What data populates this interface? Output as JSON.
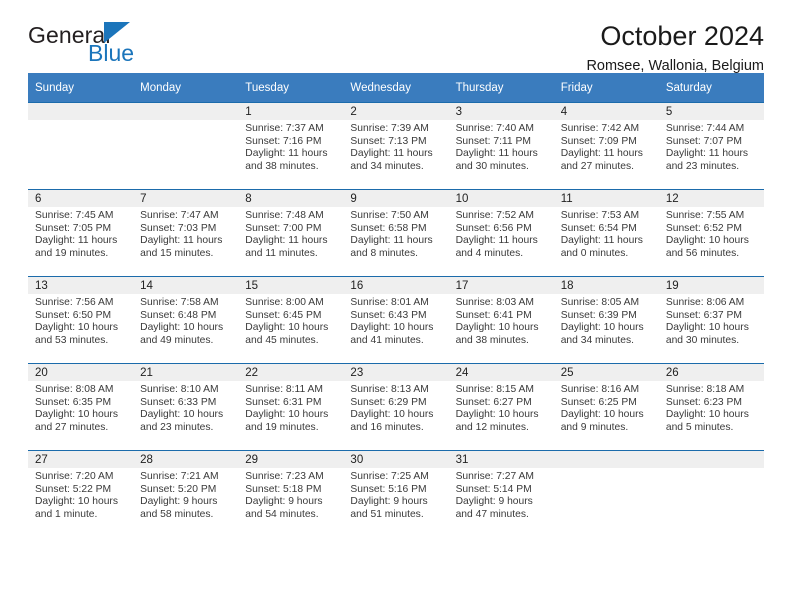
{
  "brand": {
    "name_top": "General",
    "name_bottom": "Blue",
    "triangle_color": "#1b75bb"
  },
  "header": {
    "title": "October 2024",
    "subtitle": "Romsee, Wallonia, Belgium"
  },
  "calendar": {
    "header_bg": "#3a7cbe",
    "row_border_color": "#1b6bab",
    "daynum_bg": "#efefef",
    "weekdays": [
      "Sunday",
      "Monday",
      "Tuesday",
      "Wednesday",
      "Thursday",
      "Friday",
      "Saturday"
    ],
    "labels": {
      "sunrise": "Sunrise:",
      "sunset": "Sunset:",
      "daylight": "Daylight:"
    },
    "weeks": [
      [
        {
          "day": "",
          "empty": true
        },
        {
          "day": "",
          "empty": true
        },
        {
          "day": "1",
          "sunrise": "Sunrise: 7:37 AM",
          "sunset": "Sunset: 7:16 PM",
          "daylight_1": "Daylight: 11 hours",
          "daylight_2": "and 38 minutes."
        },
        {
          "day": "2",
          "sunrise": "Sunrise: 7:39 AM",
          "sunset": "Sunset: 7:13 PM",
          "daylight_1": "Daylight: 11 hours",
          "daylight_2": "and 34 minutes."
        },
        {
          "day": "3",
          "sunrise": "Sunrise: 7:40 AM",
          "sunset": "Sunset: 7:11 PM",
          "daylight_1": "Daylight: 11 hours",
          "daylight_2": "and 30 minutes."
        },
        {
          "day": "4",
          "sunrise": "Sunrise: 7:42 AM",
          "sunset": "Sunset: 7:09 PM",
          "daylight_1": "Daylight: 11 hours",
          "daylight_2": "and 27 minutes."
        },
        {
          "day": "5",
          "sunrise": "Sunrise: 7:44 AM",
          "sunset": "Sunset: 7:07 PM",
          "daylight_1": "Daylight: 11 hours",
          "daylight_2": "and 23 minutes."
        }
      ],
      [
        {
          "day": "6",
          "sunrise": "Sunrise: 7:45 AM",
          "sunset": "Sunset: 7:05 PM",
          "daylight_1": "Daylight: 11 hours",
          "daylight_2": "and 19 minutes."
        },
        {
          "day": "7",
          "sunrise": "Sunrise: 7:47 AM",
          "sunset": "Sunset: 7:03 PM",
          "daylight_1": "Daylight: 11 hours",
          "daylight_2": "and 15 minutes."
        },
        {
          "day": "8",
          "sunrise": "Sunrise: 7:48 AM",
          "sunset": "Sunset: 7:00 PM",
          "daylight_1": "Daylight: 11 hours",
          "daylight_2": "and 11 minutes."
        },
        {
          "day": "9",
          "sunrise": "Sunrise: 7:50 AM",
          "sunset": "Sunset: 6:58 PM",
          "daylight_1": "Daylight: 11 hours",
          "daylight_2": "and 8 minutes."
        },
        {
          "day": "10",
          "sunrise": "Sunrise: 7:52 AM",
          "sunset": "Sunset: 6:56 PM",
          "daylight_1": "Daylight: 11 hours",
          "daylight_2": "and 4 minutes."
        },
        {
          "day": "11",
          "sunrise": "Sunrise: 7:53 AM",
          "sunset": "Sunset: 6:54 PM",
          "daylight_1": "Daylight: 11 hours",
          "daylight_2": "and 0 minutes."
        },
        {
          "day": "12",
          "sunrise": "Sunrise: 7:55 AM",
          "sunset": "Sunset: 6:52 PM",
          "daylight_1": "Daylight: 10 hours",
          "daylight_2": "and 56 minutes."
        }
      ],
      [
        {
          "day": "13",
          "sunrise": "Sunrise: 7:56 AM",
          "sunset": "Sunset: 6:50 PM",
          "daylight_1": "Daylight: 10 hours",
          "daylight_2": "and 53 minutes."
        },
        {
          "day": "14",
          "sunrise": "Sunrise: 7:58 AM",
          "sunset": "Sunset: 6:48 PM",
          "daylight_1": "Daylight: 10 hours",
          "daylight_2": "and 49 minutes."
        },
        {
          "day": "15",
          "sunrise": "Sunrise: 8:00 AM",
          "sunset": "Sunset: 6:45 PM",
          "daylight_1": "Daylight: 10 hours",
          "daylight_2": "and 45 minutes."
        },
        {
          "day": "16",
          "sunrise": "Sunrise: 8:01 AM",
          "sunset": "Sunset: 6:43 PM",
          "daylight_1": "Daylight: 10 hours",
          "daylight_2": "and 41 minutes."
        },
        {
          "day": "17",
          "sunrise": "Sunrise: 8:03 AM",
          "sunset": "Sunset: 6:41 PM",
          "daylight_1": "Daylight: 10 hours",
          "daylight_2": "and 38 minutes."
        },
        {
          "day": "18",
          "sunrise": "Sunrise: 8:05 AM",
          "sunset": "Sunset: 6:39 PM",
          "daylight_1": "Daylight: 10 hours",
          "daylight_2": "and 34 minutes."
        },
        {
          "day": "19",
          "sunrise": "Sunrise: 8:06 AM",
          "sunset": "Sunset: 6:37 PM",
          "daylight_1": "Daylight: 10 hours",
          "daylight_2": "and 30 minutes."
        }
      ],
      [
        {
          "day": "20",
          "sunrise": "Sunrise: 8:08 AM",
          "sunset": "Sunset: 6:35 PM",
          "daylight_1": "Daylight: 10 hours",
          "daylight_2": "and 27 minutes."
        },
        {
          "day": "21",
          "sunrise": "Sunrise: 8:10 AM",
          "sunset": "Sunset: 6:33 PM",
          "daylight_1": "Daylight: 10 hours",
          "daylight_2": "and 23 minutes."
        },
        {
          "day": "22",
          "sunrise": "Sunrise: 8:11 AM",
          "sunset": "Sunset: 6:31 PM",
          "daylight_1": "Daylight: 10 hours",
          "daylight_2": "and 19 minutes."
        },
        {
          "day": "23",
          "sunrise": "Sunrise: 8:13 AM",
          "sunset": "Sunset: 6:29 PM",
          "daylight_1": "Daylight: 10 hours",
          "daylight_2": "and 16 minutes."
        },
        {
          "day": "24",
          "sunrise": "Sunrise: 8:15 AM",
          "sunset": "Sunset: 6:27 PM",
          "daylight_1": "Daylight: 10 hours",
          "daylight_2": "and 12 minutes."
        },
        {
          "day": "25",
          "sunrise": "Sunrise: 8:16 AM",
          "sunset": "Sunset: 6:25 PM",
          "daylight_1": "Daylight: 10 hours",
          "daylight_2": "and 9 minutes."
        },
        {
          "day": "26",
          "sunrise": "Sunrise: 8:18 AM",
          "sunset": "Sunset: 6:23 PM",
          "daylight_1": "Daylight: 10 hours",
          "daylight_2": "and 5 minutes."
        }
      ],
      [
        {
          "day": "27",
          "sunrise": "Sunrise: 7:20 AM",
          "sunset": "Sunset: 5:22 PM",
          "daylight_1": "Daylight: 10 hours",
          "daylight_2": "and 1 minute."
        },
        {
          "day": "28",
          "sunrise": "Sunrise: 7:21 AM",
          "sunset": "Sunset: 5:20 PM",
          "daylight_1": "Daylight: 9 hours",
          "daylight_2": "and 58 minutes."
        },
        {
          "day": "29",
          "sunrise": "Sunrise: 7:23 AM",
          "sunset": "Sunset: 5:18 PM",
          "daylight_1": "Daylight: 9 hours",
          "daylight_2": "and 54 minutes."
        },
        {
          "day": "30",
          "sunrise": "Sunrise: 7:25 AM",
          "sunset": "Sunset: 5:16 PM",
          "daylight_1": "Daylight: 9 hours",
          "daylight_2": "and 51 minutes."
        },
        {
          "day": "31",
          "sunrise": "Sunrise: 7:27 AM",
          "sunset": "Sunset: 5:14 PM",
          "daylight_1": "Daylight: 9 hours",
          "daylight_2": "and 47 minutes."
        },
        {
          "day": "",
          "empty": true
        },
        {
          "day": "",
          "empty": true
        }
      ]
    ]
  }
}
